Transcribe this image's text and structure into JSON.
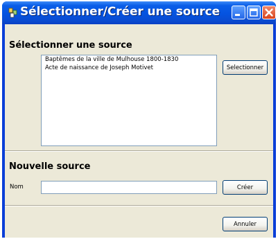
{
  "window": {
    "title": "Sélectionner/Créer une source"
  },
  "select_section": {
    "heading": "Sélectionner une source",
    "items": [
      "Baptêmes de la ville de Mulhouse 1800-1830",
      "Acte de naissance de Joseph Motivet"
    ],
    "select_button": "Selectionner"
  },
  "new_section": {
    "heading": "Nouvelle source",
    "name_label": "Nom",
    "name_value": "",
    "create_button": "Créer"
  },
  "footer": {
    "cancel_button": "Annuler"
  },
  "icons": {
    "app": "app-icon",
    "minimize": "minimize-icon",
    "maximize": "maximize-icon",
    "close": "close-icon"
  },
  "colors": {
    "titlebar": "#0553e0",
    "close_button": "#d9431c",
    "dialog_face": "#ece9d8"
  }
}
